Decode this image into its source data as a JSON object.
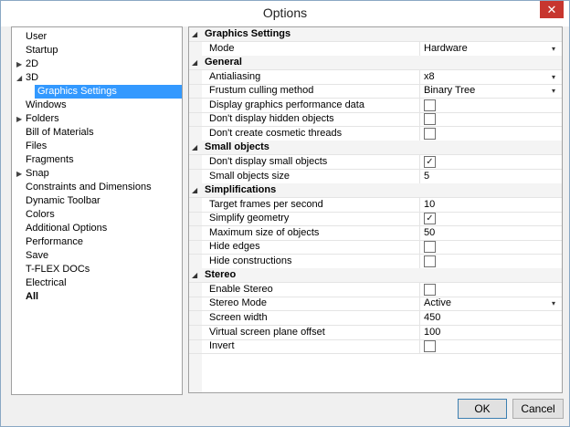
{
  "window": {
    "title": "Options",
    "close_glyph": "✕"
  },
  "tree": [
    {
      "label": "User",
      "level": 0,
      "arrow": ""
    },
    {
      "label": "Startup",
      "level": 0,
      "arrow": ""
    },
    {
      "label": "2D",
      "level": 0,
      "arrow": "▶"
    },
    {
      "label": "3D",
      "level": 0,
      "arrow": "◢"
    },
    {
      "label": "Graphics Settings",
      "level": 1,
      "arrow": "",
      "selected": true
    },
    {
      "label": "Windows",
      "level": 0,
      "arrow": ""
    },
    {
      "label": "Folders",
      "level": 0,
      "arrow": "▶"
    },
    {
      "label": "Bill of Materials",
      "level": 0,
      "arrow": ""
    },
    {
      "label": "Files",
      "level": 0,
      "arrow": ""
    },
    {
      "label": "Fragments",
      "level": 0,
      "arrow": ""
    },
    {
      "label": "Snap",
      "level": 0,
      "arrow": "▶"
    },
    {
      "label": "Constraints and Dimensions",
      "level": 0,
      "arrow": ""
    },
    {
      "label": "Dynamic Toolbar",
      "level": 0,
      "arrow": ""
    },
    {
      "label": "Colors",
      "level": 0,
      "arrow": ""
    },
    {
      "label": "Additional Options",
      "level": 0,
      "arrow": ""
    },
    {
      "label": "Performance",
      "level": 0,
      "arrow": ""
    },
    {
      "label": "Save",
      "level": 0,
      "arrow": ""
    },
    {
      "label": "T-FLEX DOCs",
      "level": 0,
      "arrow": ""
    },
    {
      "label": "Electrical",
      "level": 0,
      "arrow": ""
    },
    {
      "label": "All",
      "level": 0,
      "arrow": "",
      "bold": true
    }
  ],
  "properties": [
    {
      "kind": "category",
      "label": "Graphics Settings"
    },
    {
      "kind": "dropdown",
      "label": "Mode",
      "value": "Hardware"
    },
    {
      "kind": "category",
      "label": "General"
    },
    {
      "kind": "dropdown",
      "label": "Antialiasing",
      "value": "x8"
    },
    {
      "kind": "dropdown",
      "label": "Frustum culling method",
      "value": "Binary Tree"
    },
    {
      "kind": "checkbox",
      "label": "Display graphics performance data",
      "checked": false
    },
    {
      "kind": "checkbox",
      "label": "Don't display hidden objects",
      "checked": false
    },
    {
      "kind": "checkbox",
      "label": "Don't create cosmetic threads",
      "checked": false
    },
    {
      "kind": "category",
      "label": "Small objects"
    },
    {
      "kind": "checkbox",
      "label": "Don't display small objects",
      "checked": true
    },
    {
      "kind": "text",
      "label": "Small objects size",
      "value": "5"
    },
    {
      "kind": "category",
      "label": "Simplifications"
    },
    {
      "kind": "text",
      "label": "Target frames per second",
      "value": "10"
    },
    {
      "kind": "checkbox",
      "label": "Simplify geometry",
      "checked": true
    },
    {
      "kind": "text",
      "label": "Maximum size of objects",
      "value": "50"
    },
    {
      "kind": "checkbox",
      "label": "Hide edges",
      "checked": false
    },
    {
      "kind": "checkbox",
      "label": "Hide constructions",
      "checked": false
    },
    {
      "kind": "category",
      "label": "Stereo"
    },
    {
      "kind": "checkbox",
      "label": "Enable Stereo",
      "checked": false
    },
    {
      "kind": "dropdown",
      "label": "Stereo Mode",
      "value": "Active"
    },
    {
      "kind": "text",
      "label": "Screen width",
      "value": "450"
    },
    {
      "kind": "text",
      "label": "Virtual screen plane offset",
      "value": "100"
    },
    {
      "kind": "checkbox",
      "label": "Invert",
      "checked": false
    }
  ],
  "buttons": {
    "ok": "OK",
    "cancel": "Cancel"
  },
  "colors": {
    "selection": "#3399ff",
    "close": "#c7362f"
  }
}
